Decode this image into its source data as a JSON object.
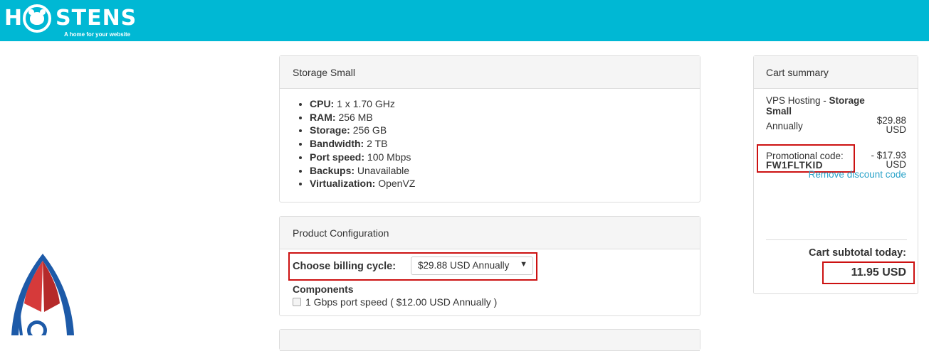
{
  "header": {
    "brand_left": "H",
    "brand_right": "STENS",
    "tagline": "A home for your website",
    "bg_color": "#00b8d4"
  },
  "product": {
    "title": "Storage Small",
    "specs": [
      {
        "label": "CPU:",
        "value": "1 x 1.70 GHz"
      },
      {
        "label": "RAM:",
        "value": "256 MB"
      },
      {
        "label": "Storage:",
        "value": "256 GB"
      },
      {
        "label": "Bandwidth:",
        "value": "2 TB"
      },
      {
        "label": "Port speed:",
        "value": "100 Mbps"
      },
      {
        "label": "Backups:",
        "value": "Unavailable"
      },
      {
        "label": "Virtualization:",
        "value": "OpenVZ"
      }
    ]
  },
  "config": {
    "title": "Product Configuration",
    "billing_label": "Choose billing cycle:",
    "billing_selected": "$29.88 USD Annually",
    "components_title": "Components",
    "component_option": "1 Gbps port speed ( $12.00 USD Annually )"
  },
  "summary": {
    "title": "Cart summary",
    "product_prefix": "VPS Hosting - ",
    "product_name_1": "Storage",
    "product_name_2": "Small",
    "cycle": "Annually",
    "price": "$29.88",
    "price_currency": "USD",
    "promo_label": "Promotional code:",
    "promo_code": "FW1FLTKID",
    "promo_amount": "- $17.93",
    "promo_currency": "USD",
    "remove_link": "Remove discount code",
    "subtotal_label": "Cart subtotal today:",
    "subtotal_value": "11.95 USD",
    "link_color": "#2aa3c9",
    "highlight_color": "#cc1111"
  }
}
